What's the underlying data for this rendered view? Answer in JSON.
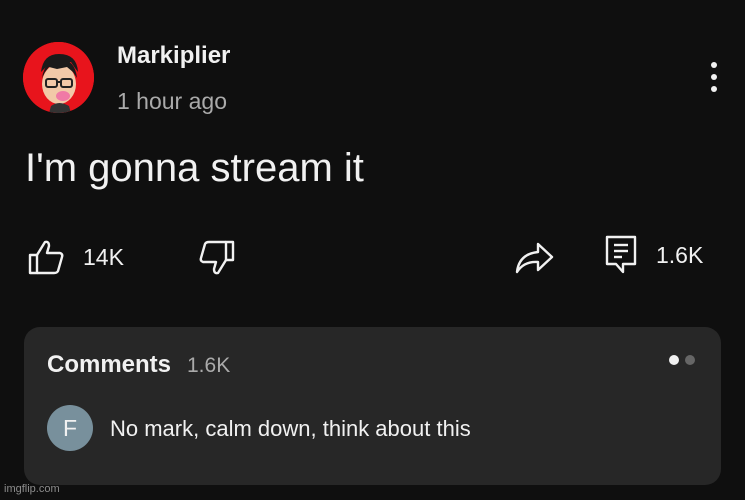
{
  "post": {
    "channel_name": "Markiplier",
    "posted_time": "1 hour ago",
    "text": "I'm gonna stream it"
  },
  "actions": {
    "like_count": "14K",
    "comment_count": "1.6K"
  },
  "comments": {
    "title": "Comments",
    "count": "1.6K",
    "top_comment": {
      "avatar_letter": "F",
      "text": "No mark, calm down, think about this"
    }
  },
  "icons": {
    "menu": "more-vert-icon",
    "like": "thumbs-up-icon",
    "dislike": "thumbs-down-icon",
    "share": "share-arrow-icon",
    "comment": "comment-icon"
  },
  "colors": {
    "background": "#0f0f0f",
    "panel": "#272727",
    "avatar_bg": "#e8141c",
    "secondary_text": "#aaaaaa",
    "comment_avatar_bg": "#78909c"
  },
  "watermark": "imgflip.com"
}
